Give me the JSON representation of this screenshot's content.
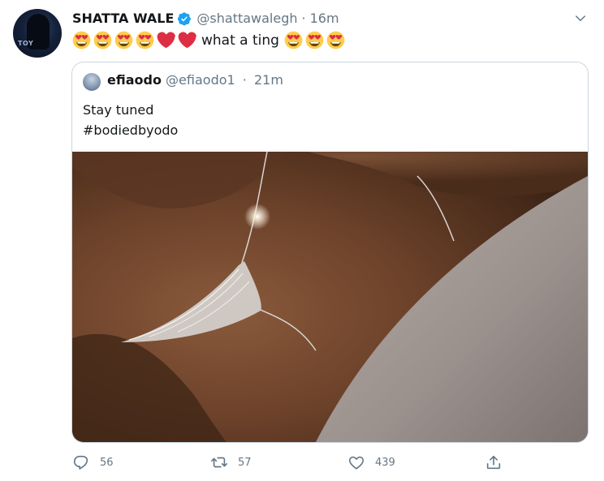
{
  "tweet": {
    "author_name": "SHATTA WALE",
    "handle": "@shattawalegh",
    "separator": "·",
    "time": "16m",
    "avatar_label": "TOY",
    "text": "what a ting",
    "emojis_before": [
      "heart-eyes",
      "heart-eyes",
      "heart-eyes",
      "heart-eyes",
      "red-heart",
      "red-heart"
    ],
    "emojis_after": [
      "heart-eyes",
      "heart-eyes",
      "heart-eyes"
    ]
  },
  "quote": {
    "author_name": "efiaodo",
    "handle": "@efiaodo1",
    "separator": "·",
    "time": "21m",
    "text_line1": "Stay tuned",
    "text_line2": "#bodiedbyodo"
  },
  "actions": {
    "reply_count": "56",
    "retweet_count": "57",
    "like_count": "439"
  },
  "colors": {
    "verified": "#1da1f2",
    "secondary_text": "#657786",
    "border": "#ccd6dd"
  }
}
